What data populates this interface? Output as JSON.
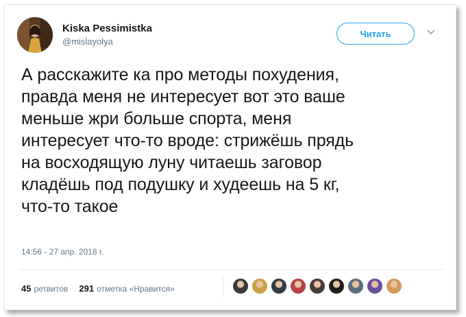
{
  "tweet": {
    "author_name": "Kiska Pessimistka",
    "author_handle": "@mislayolya",
    "follow_label": "Читать",
    "text": "А расскажите ка про методы похудения,\nправда меня не интересует вот это ваше\nменьше жри больше спорта, меня\nинтересует что-то вроде: стрижёшь прядь\nна восходящую луну читаешь заговор\nкладёшь под подушку и худеешь на 5 кг,\nчто-то такое",
    "timestamp": "14:56 - 27 апр. 2018 г.",
    "retweets_count": "45",
    "retweets_label": "ретвитов",
    "likes_count": "291",
    "likes_label": "отметка «Нравится»",
    "liker_avatars": [
      {
        "color": "#3a3a3a"
      },
      {
        "color": "#c9a24a"
      },
      {
        "color": "#2f3b45"
      },
      {
        "color": "#b8414a"
      },
      {
        "color": "#4a3a35"
      },
      {
        "color": "#1e1e1e"
      },
      {
        "color": "#5b6d80"
      },
      {
        "color": "#6d4fa0"
      },
      {
        "color": "#d49a5a"
      }
    ]
  },
  "colors": {
    "accent": "#1da1f2",
    "text_primary": "#14171a",
    "text_secondary": "#657786",
    "border": "#e1e8ed"
  }
}
